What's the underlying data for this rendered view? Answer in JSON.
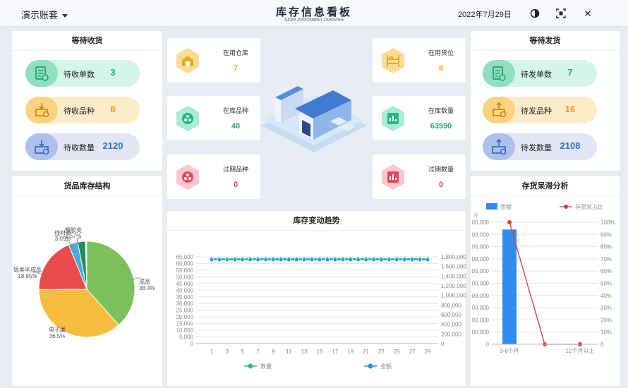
{
  "header": {
    "account": "演示账套",
    "title": "库存信息看板",
    "subtitle": "Store Information Overview",
    "date": "2022年7月29日"
  },
  "colors": {
    "green": "#23b381",
    "orange": "#f5a623",
    "blue": "#2c6fc9",
    "red": "#e8455b"
  },
  "receiving": {
    "title": "等待收货",
    "items": [
      {
        "label": "待收单数",
        "value": "3"
      },
      {
        "label": "待收品种",
        "value": "8"
      },
      {
        "label": "待收数量",
        "value": "2120"
      }
    ]
  },
  "shipping": {
    "title": "等待发货",
    "items": [
      {
        "label": "待发单数",
        "value": "7"
      },
      {
        "label": "待发品种",
        "value": "16"
      },
      {
        "label": "待发数量",
        "value": "2108"
      }
    ]
  },
  "stats": {
    "warehouses": {
      "label": "在用仓库",
      "value": "7"
    },
    "locations": {
      "label": "在用货位",
      "value": "8"
    },
    "varieties": {
      "label": "在库品种",
      "value": "48"
    },
    "quantity": {
      "label": "在库数量",
      "value": "63590"
    },
    "expired_varieties": {
      "label": "过期品种",
      "value": "0"
    },
    "expired_quantity": {
      "label": "过期数量",
      "value": "0"
    }
  },
  "chart_data": [
    {
      "type": "pie",
      "title": "货品库存结构",
      "slices": [
        {
          "name": "成品",
          "percent": 38.4,
          "color": "#7bc25a"
        },
        {
          "name": "电子类",
          "percent": 36.5,
          "color": "#f7bd3e"
        },
        {
          "name": "钣类半成品",
          "percent": 18.95,
          "color": "#e84c4c"
        },
        {
          "name": "线材类",
          "percent": 3.09,
          "color": "#4aa8d8"
        },
        {
          "name": "塑胶类",
          "percent": 2.57,
          "color": "#1e8f5a"
        }
      ],
      "labels": [
        "成品",
        "38.4%",
        "电子类",
        "36.5%",
        "钣类半成品",
        "18.95%",
        "线材类",
        "3.09%",
        "塑胶类",
        "2.57%"
      ]
    },
    {
      "type": "line",
      "title": "库存变动趋势",
      "x": [
        1,
        2,
        3,
        4,
        5,
        6,
        7,
        8,
        9,
        10,
        11,
        12,
        13,
        14,
        15,
        16,
        17,
        18,
        19,
        20,
        21,
        22,
        23,
        24,
        25,
        26,
        27,
        28,
        29
      ],
      "xticks": [
        "1",
        "3",
        "5",
        "7",
        "9",
        "11",
        "13",
        "15",
        "17",
        "19",
        "21",
        "23",
        "25",
        "27",
        "29"
      ],
      "series": [
        {
          "name": "数量",
          "axis": "left",
          "color": "#1fc18e",
          "values": [
            63590,
            63590,
            63590,
            63590,
            63590,
            63590,
            63590,
            63590,
            63590,
            63590,
            63590,
            63590,
            63590,
            63590,
            63590,
            63590,
            63590,
            63590,
            63590,
            63590,
            63590,
            63590,
            63590,
            63590,
            63590,
            63590,
            63590,
            63590,
            63590
          ]
        },
        {
          "name": "金额",
          "axis": "right",
          "color": "#1e9be0",
          "values": [
            1740000,
            1740000,
            1740000,
            1740000,
            1740000,
            1740000,
            1740000,
            1740000,
            1740000,
            1740000,
            1740000,
            1740000,
            1740000,
            1740000,
            1740000,
            1740000,
            1740000,
            1740000,
            1740000,
            1740000,
            1740000,
            1740000,
            1740000,
            1740000,
            1740000,
            1740000,
            1740000,
            1740000,
            1740000
          ]
        }
      ],
      "yticks_left": [
        "0",
        "5,000",
        "10,000",
        "15,000",
        "20,000",
        "25,000",
        "30,000",
        "35,000",
        "40,000",
        "45,000",
        "50,000",
        "55,000",
        "60,000",
        "65,000"
      ],
      "yticks_right": [
        "0",
        "200,000",
        "400,000",
        "600,000",
        "800,000",
        "1,000,000",
        "1,200,000",
        "1,400,000",
        "1,600,000",
        "1,800,000"
      ],
      "ylim_left": [
        0,
        65000
      ],
      "ylim_right": [
        0,
        1800000
      ],
      "grid": true,
      "legend": "bottom"
    },
    {
      "type": "bar",
      "title": "存货呆滞分析",
      "categories": [
        "3-6个月",
        "",
        "12个月以上"
      ],
      "series": [
        {
          "name": "金额",
          "type": "bar",
          "axis": "left",
          "color": "#2e8df0",
          "values": [
            1800000,
            0,
            0
          ]
        },
        {
          "name": "存货总占比",
          "type": "line",
          "axis": "right",
          "color": "#e8333b",
          "values": [
            100,
            0,
            0
          ]
        }
      ],
      "left_axis_unit": "元",
      "yticks_left": [
        "0",
        "00,000",
        "00,000",
        "00,000",
        "00,000",
        "00,000",
        "00,000",
        "00,000",
        "00,000",
        "00,000",
        "00,000"
      ],
      "yticks_right": [
        "0",
        "10%",
        "20%",
        "30%",
        "40%",
        "50%",
        "60%",
        "70%",
        "80%",
        "90%",
        "100%"
      ],
      "ylim_right": [
        0,
        100
      ],
      "legend": "top",
      "grid": true
    }
  ]
}
